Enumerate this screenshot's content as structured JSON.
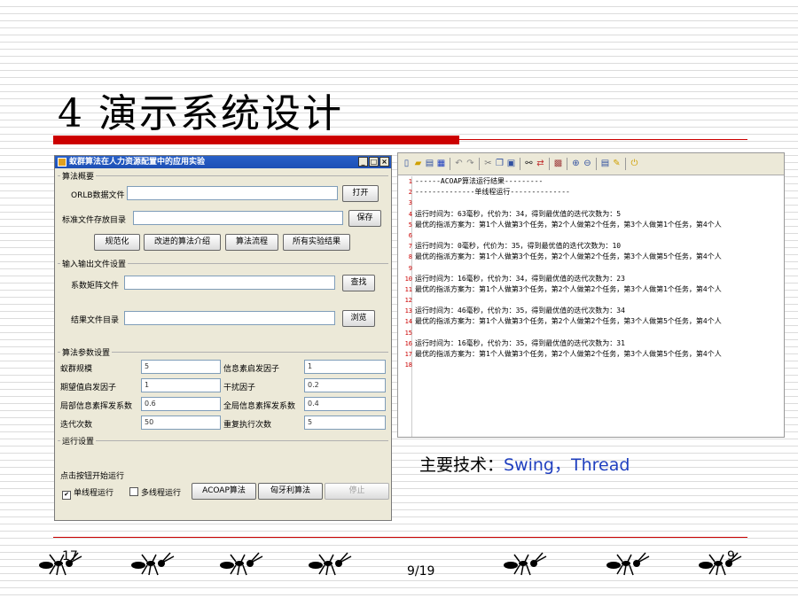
{
  "slide": {
    "title": "4 演示系统设计",
    "tech_label": "主要技术：",
    "tech_value": "Swing，Thread",
    "page": "9/19",
    "footer_left": "17",
    "footer_right": "9"
  },
  "window": {
    "title": "蚁群算法在人力资源配置中的应用实验",
    "controls": [
      "_",
      "□",
      "×"
    ],
    "section_algo": "算法概要",
    "orlb_label": "ORLB数据文件",
    "orlb_value": "",
    "open_btn": "打开",
    "std_label": "标准文件存放目录",
    "std_value": "",
    "save_btn": "保存",
    "algo_buttons": [
      "规范化",
      "改进的算法介绍",
      "算法流程",
      "所有实验结果"
    ],
    "section_io": "输入输出文件设置",
    "matrix_label": "系数矩阵文件",
    "matrix_value": "",
    "find_btn": "查找",
    "result_label": "结果文件目录",
    "result_value": "",
    "browse_btn": "浏览",
    "section_params": "算法参数设置",
    "params": [
      {
        "label": "蚁群规模",
        "value": "5"
      },
      {
        "label": "信息素启发因子",
        "value": "1"
      },
      {
        "label": "期望值启发因子",
        "value": "1"
      },
      {
        "label": "干扰因子",
        "value": "0.2"
      },
      {
        "label": "局部信息素挥发系数",
        "value": "0.6"
      },
      {
        "label": "全局信息素挥发系数",
        "value": "0.4"
      },
      {
        "label": "迭代次数",
        "value": "50"
      },
      {
        "label": "重复执行次数",
        "value": "5"
      }
    ],
    "section_run": "运行设置",
    "run_prompt": "点击按钮开始运行",
    "single_thread": "单线程运行",
    "single_checked": "✔",
    "multi_thread": "多线程运行",
    "acoap_btn": "ACOAP算法",
    "hungarian_btn": "匈牙利算法",
    "stop_btn": "停止"
  },
  "editor": {
    "toolbar_icons": [
      "new-icon",
      "open-icon",
      "save-icon",
      "undo-icon",
      "redo-icon",
      "cut-icon",
      "copy-icon",
      "paste-icon",
      "find-icon",
      "replace-icon",
      "bookmark-icon",
      "zoom-in-icon",
      "zoom-out-icon",
      "wrap-icon",
      "edit-icon",
      "exit-icon"
    ],
    "lines": [
      {
        "n": "1",
        "t": "------ACOAP算法运行结果---------"
      },
      {
        "n": "2",
        "t": "--------------单线程运行--------------"
      },
      {
        "n": "3",
        "t": ""
      },
      {
        "n": "4",
        "t": "运行时间为：63毫秒，代价为：34，得到最优值的迭代次数为：5"
      },
      {
        "n": "5",
        "t": "最优的指派方案为：第1个人做第3个任务，第2个人做第2个任务，第3个人做第1个任务，第4个人"
      },
      {
        "n": "6",
        "t": ""
      },
      {
        "n": "7",
        "t": "运行时间为：0毫秒，代价为：35，得到最优值的迭代次数为：10"
      },
      {
        "n": "8",
        "t": "最优的指派方案为：第1个人做第3个任务，第2个人做第2个任务，第3个人做第5个任务，第4个人"
      },
      {
        "n": "9",
        "t": ""
      },
      {
        "n": "10",
        "t": "运行时间为：16毫秒，代价为：34，得到最优值的迭代次数为：23"
      },
      {
        "n": "11",
        "t": "最优的指派方案为：第1个人做第3个任务，第2个人做第2个任务，第3个人做第1个任务，第4个人"
      },
      {
        "n": "12",
        "t": ""
      },
      {
        "n": "13",
        "t": "运行时间为：46毫秒，代价为：35，得到最优值的迭代次数为：34"
      },
      {
        "n": "14",
        "t": "最优的指派方案为：第1个人做第3个任务，第2个人做第2个任务，第3个人做第5个任务，第4个人"
      },
      {
        "n": "15",
        "t": ""
      },
      {
        "n": "16",
        "t": "运行时间为：16毫秒，代价为：35，得到最优值的迭代次数为：31"
      },
      {
        "n": "17",
        "t": "最优的指派方案为：第1个人做第3个任务，第2个人做第2个任务，第3个人做第5个任务，第4个人"
      },
      {
        "n": "18",
        "t": ""
      }
    ]
  }
}
